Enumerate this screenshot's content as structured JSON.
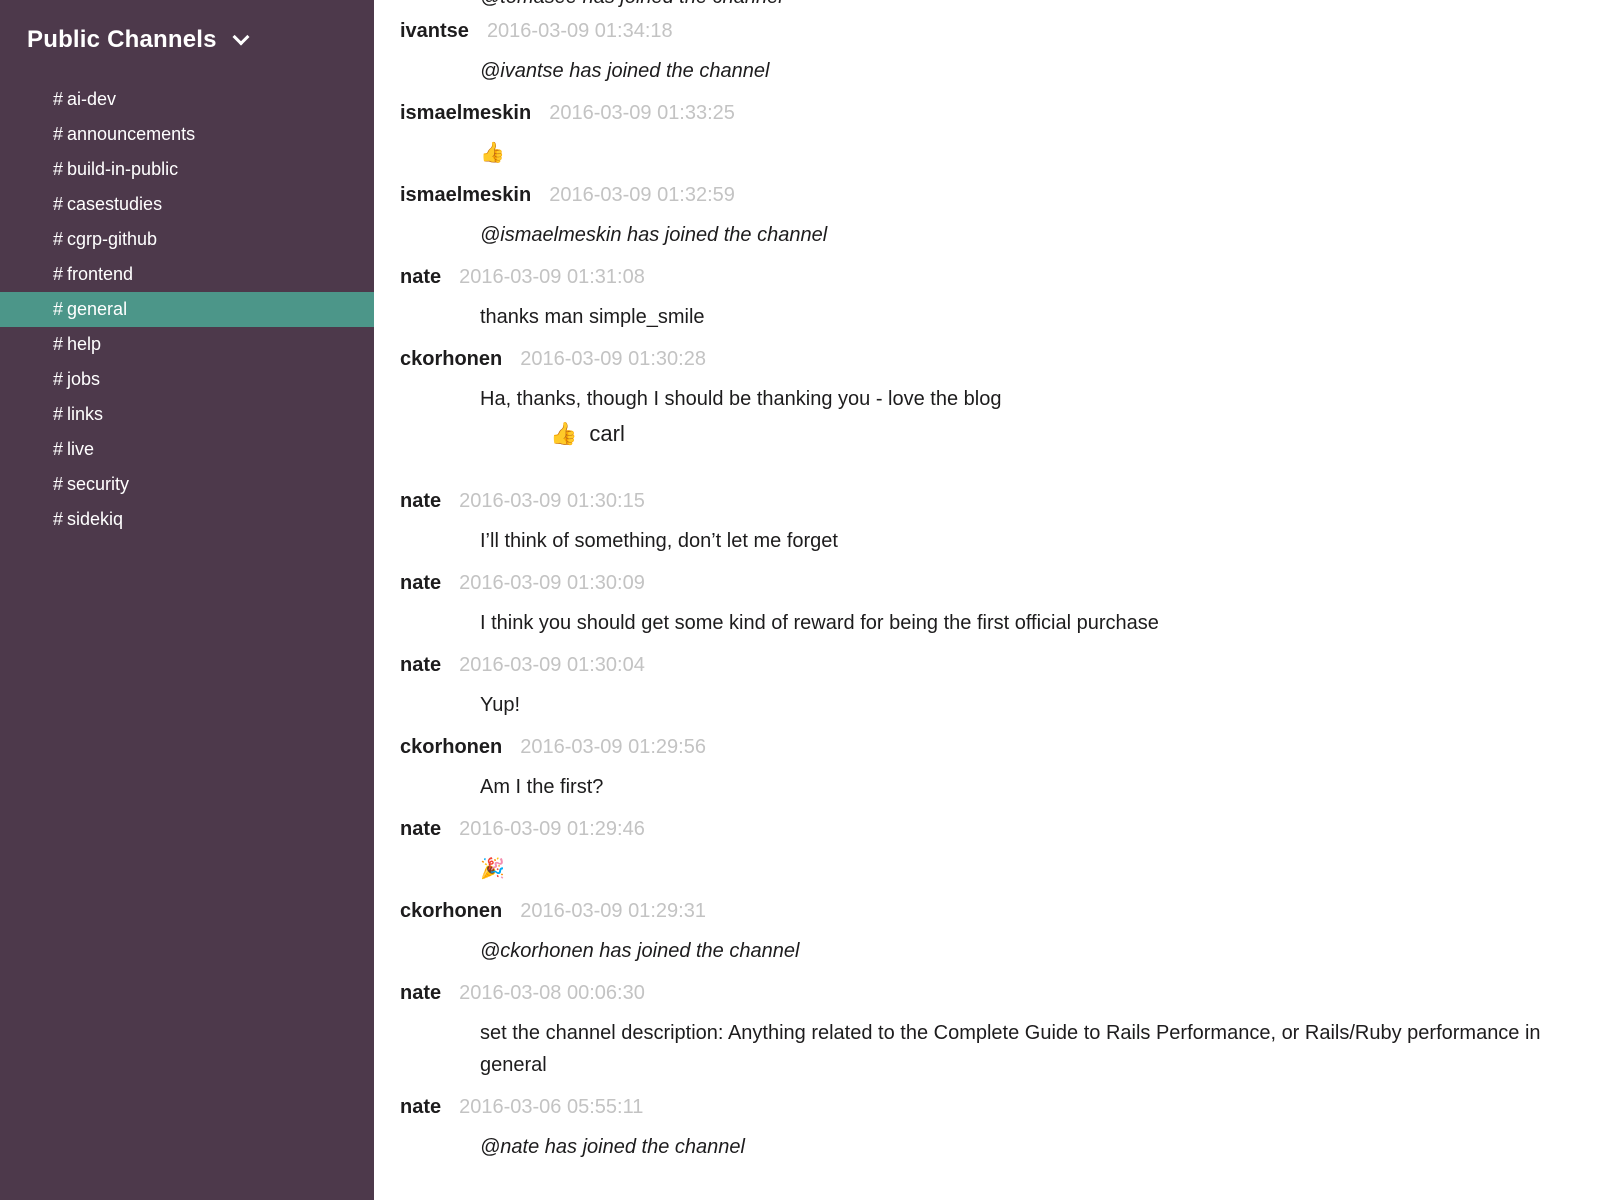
{
  "sidebar": {
    "title": "Public Channels",
    "channels": [
      {
        "hash": "#",
        "name": "ai-dev"
      },
      {
        "hash": "#",
        "name": "announcements"
      },
      {
        "hash": "#",
        "name": "build-in-public"
      },
      {
        "hash": "#",
        "name": "casestudies"
      },
      {
        "hash": "#",
        "name": "cgrp-github"
      },
      {
        "hash": "#",
        "name": "frontend"
      },
      {
        "hash": "#",
        "name": "general"
      },
      {
        "hash": "#",
        "name": "help"
      },
      {
        "hash": "#",
        "name": "jobs"
      },
      {
        "hash": "#",
        "name": "links"
      },
      {
        "hash": "#",
        "name": "live"
      },
      {
        "hash": "#",
        "name": "security"
      },
      {
        "hash": "#",
        "name": "sidekiq"
      }
    ],
    "active_channel": "general"
  },
  "colors": {
    "sidebar_bg": "#4d394b",
    "active_item_bg": "#4c9689",
    "timestamp": "#c3c3c3"
  },
  "messages": {
    "partial_top": "@tomasee has joined the channel",
    "items": [
      {
        "author": "ivantse",
        "time": "2016-03-09 01:34:18",
        "text": "@ivantse has joined the channel",
        "system": true
      },
      {
        "author": "ismaelmeskin",
        "time": "2016-03-09 01:33:25",
        "emoji": "👍",
        "icon": "thumbs-up-icon"
      },
      {
        "author": "ismaelmeskin",
        "time": "2016-03-09 01:32:59",
        "text": "@ismaelmeskin has joined the channel",
        "system": true
      },
      {
        "author": "nate",
        "time": "2016-03-09 01:31:08",
        "text": "thanks man simple_smile"
      },
      {
        "author": "ckorhonen",
        "time": "2016-03-09 01:30:28",
        "text": "Ha, thanks, though I should be thanking you - love the blog",
        "reaction": {
          "emoji": "👍",
          "icon": "thumbs-up-icon",
          "label": "carl"
        }
      },
      {
        "author": "nate",
        "time": "2016-03-09 01:30:15",
        "text": "I’ll think of something, don’t let me forget"
      },
      {
        "author": "nate",
        "time": "2016-03-09 01:30:09",
        "text": "I think you should get some kind of reward for being the first official purchase"
      },
      {
        "author": "nate",
        "time": "2016-03-09 01:30:04",
        "text": "Yup!"
      },
      {
        "author": "ckorhonen",
        "time": "2016-03-09 01:29:56",
        "text": "Am I the first?"
      },
      {
        "author": "nate",
        "time": "2016-03-09 01:29:46",
        "emoji": "🎉",
        "icon": "party-popper-icon"
      },
      {
        "author": "ckorhonen",
        "time": "2016-03-09 01:29:31",
        "text": "@ckorhonen has joined the channel",
        "system": true
      },
      {
        "author": "nate",
        "time": "2016-03-08 00:06:30",
        "text": "set the channel description: Anything related to the Complete Guide to Rails Performance, or Rails/Ruby performance in general"
      },
      {
        "author": "nate",
        "time": "2016-03-06 05:55:11",
        "text": "@nate has joined the channel",
        "system": true
      }
    ]
  }
}
